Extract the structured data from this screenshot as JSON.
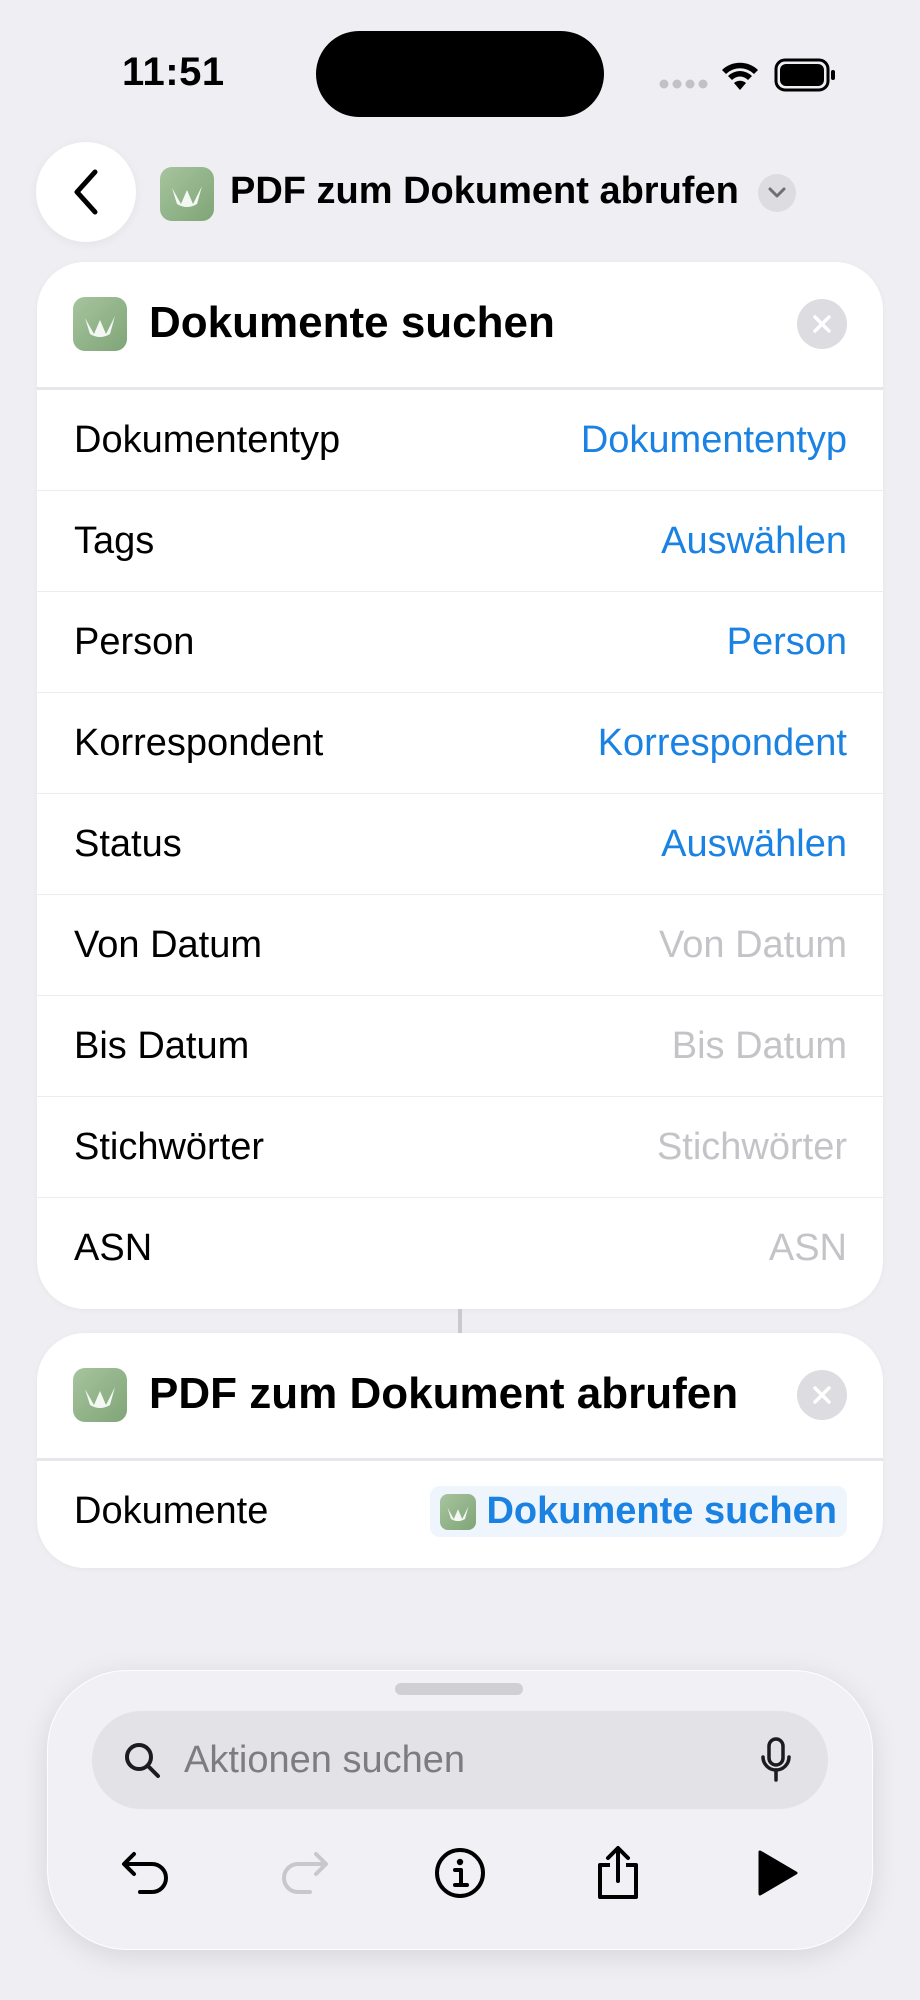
{
  "status_bar": {
    "time": "11:51"
  },
  "header": {
    "title": "PDF zum Dokument abrufen"
  },
  "cards": [
    {
      "title": "Dokumente suchen",
      "rows": [
        {
          "label": "Dokumententyp",
          "value": "Dokumententyp",
          "placeholder": false
        },
        {
          "label": "Tags",
          "value": "Auswählen",
          "placeholder": false
        },
        {
          "label": "Person",
          "value": "Person",
          "placeholder": false
        },
        {
          "label": "Korrespondent",
          "value": "Korrespondent",
          "placeholder": false
        },
        {
          "label": "Status",
          "value": "Auswählen",
          "placeholder": false
        },
        {
          "label": "Von Datum",
          "value": "Von Datum",
          "placeholder": true
        },
        {
          "label": "Bis Datum",
          "value": "Bis Datum",
          "placeholder": true
        },
        {
          "label": "Stichwörter",
          "value": "Stichwörter",
          "placeholder": true
        },
        {
          "label": "ASN",
          "value": "ASN",
          "placeholder": true
        }
      ]
    },
    {
      "title": "PDF zum Dokument abrufen",
      "rows": [
        {
          "label": "Dokumente",
          "value": "Dokumente suchen"
        }
      ]
    }
  ],
  "search": {
    "placeholder": "Aktionen suchen"
  },
  "icons": {
    "back": "chevron-left-icon",
    "app": "paperless-app-icon",
    "dropdown": "chevron-down-icon",
    "close": "close-icon",
    "search": "magnifier-icon",
    "mic": "microphone-icon",
    "undo": "undo-icon",
    "redo": "redo-icon",
    "info": "info-icon",
    "share": "share-icon",
    "play": "play-icon"
  },
  "colors": {
    "accent": "#1a82e2",
    "background": "#eeeef3",
    "app_icon": "#8fb386"
  }
}
